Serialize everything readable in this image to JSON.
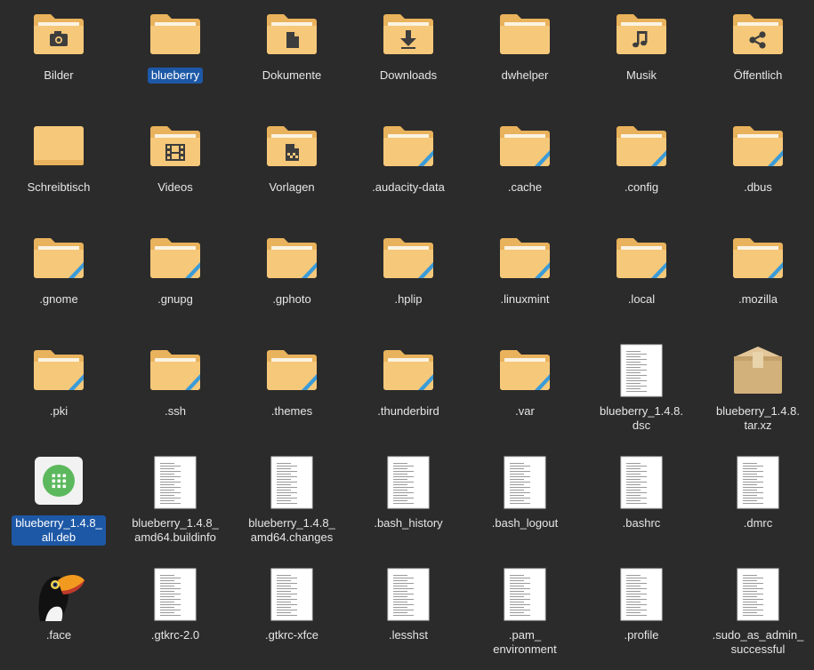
{
  "files": [
    {
      "name": "Bilder",
      "kind": "folder",
      "emblem": "camera-icon"
    },
    {
      "name": "blueberry",
      "kind": "folder",
      "emblem": "",
      "selected": true
    },
    {
      "name": "Dokumente",
      "kind": "folder",
      "emblem": "document-icon"
    },
    {
      "name": "Downloads",
      "kind": "folder",
      "emblem": "download-arrow-icon"
    },
    {
      "name": "dwhelper",
      "kind": "folder",
      "emblem": ""
    },
    {
      "name": "Musik",
      "kind": "folder",
      "emblem": "music-note-icon"
    },
    {
      "name": "Öffentlich",
      "kind": "folder",
      "emblem": "share-icon"
    },
    {
      "name": "Schreibtisch",
      "kind": "desktop-folder",
      "emblem": ""
    },
    {
      "name": "Videos",
      "kind": "folder",
      "emblem": "film-icon"
    },
    {
      "name": "Vorlagen",
      "kind": "folder",
      "emblem": "template-icon"
    },
    {
      "name": ".audacity-data",
      "kind": "folder-link",
      "emblem": ""
    },
    {
      "name": ".cache",
      "kind": "folder-link",
      "emblem": ""
    },
    {
      "name": ".config",
      "kind": "folder-link",
      "emblem": ""
    },
    {
      "name": ".dbus",
      "kind": "folder-link",
      "emblem": ""
    },
    {
      "name": ".gnome",
      "kind": "folder-link",
      "emblem": ""
    },
    {
      "name": ".gnupg",
      "kind": "folder-link",
      "emblem": ""
    },
    {
      "name": ".gphoto",
      "kind": "folder-link",
      "emblem": ""
    },
    {
      "name": ".hplip",
      "kind": "folder-link",
      "emblem": ""
    },
    {
      "name": ".linuxmint",
      "kind": "folder-link",
      "emblem": ""
    },
    {
      "name": ".local",
      "kind": "folder-link",
      "emblem": ""
    },
    {
      "name": ".mozilla",
      "kind": "folder-link",
      "emblem": ""
    },
    {
      "name": ".pki",
      "kind": "folder-link",
      "emblem": ""
    },
    {
      "name": ".ssh",
      "kind": "folder-link",
      "emblem": ""
    },
    {
      "name": ".themes",
      "kind": "folder-link",
      "emblem": ""
    },
    {
      "name": ".thunderbird",
      "kind": "folder-link",
      "emblem": ""
    },
    {
      "name": ".var",
      "kind": "folder-link",
      "emblem": ""
    },
    {
      "name": "blueberry_1.4.8.\ndsc",
      "kind": "text",
      "emblem": ""
    },
    {
      "name": "blueberry_1.4.8.\ntar.xz",
      "kind": "archive",
      "emblem": "archive-box-icon"
    },
    {
      "name": "blueberry_1.4.8_\nall.deb",
      "kind": "package",
      "emblem": "package-grid-icon",
      "selected": true
    },
    {
      "name": "blueberry_1.4.8_\namd64.buildinfo",
      "kind": "text",
      "emblem": ""
    },
    {
      "name": "blueberry_1.4.8_\namd64.changes",
      "kind": "text",
      "emblem": ""
    },
    {
      "name": ".bash_history",
      "kind": "text",
      "emblem": ""
    },
    {
      "name": ".bash_logout",
      "kind": "text",
      "emblem": ""
    },
    {
      "name": ".bashrc",
      "kind": "text",
      "emblem": ""
    },
    {
      "name": ".dmrc",
      "kind": "text",
      "emblem": ""
    },
    {
      "name": ".face",
      "kind": "image",
      "emblem": "toucan-icon"
    },
    {
      "name": ".gtkrc-2.0",
      "kind": "text",
      "emblem": ""
    },
    {
      "name": ".gtkrc-xfce",
      "kind": "text",
      "emblem": ""
    },
    {
      "name": ".lesshst",
      "kind": "text",
      "emblem": ""
    },
    {
      "name": ".pam_\nenvironment",
      "kind": "text",
      "emblem": ""
    },
    {
      "name": ".profile",
      "kind": "text",
      "emblem": ""
    },
    {
      "name": ".sudo_as_admin_\nsuccessful",
      "kind": "text",
      "emblem": ""
    }
  ],
  "colors": {
    "background": "#2b2b2b",
    "folder_back": "#e9b25c",
    "folder_front": "#f6c87a",
    "folder_emblem": "#3d3d3d",
    "link_stripe": "#3a9bd9",
    "selection": "#1d58a6",
    "label": "#e6e6e6",
    "package_green": "#5cb85c"
  }
}
